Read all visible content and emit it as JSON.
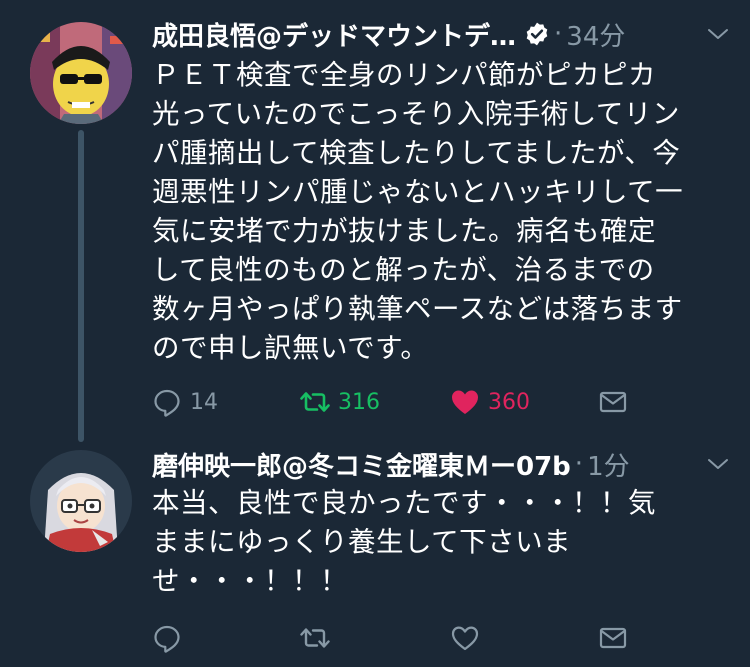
{
  "tweets": [
    {
      "author": "成田良悟@デッドマウントデ…",
      "verified": true,
      "separator": "·",
      "time": "34分",
      "text": "ＰＥＴ検査で全身のリンパ節がピカピカ\n光っていたのでこっそり入院手術してリン\nパ腫摘出して検査したりしてましたが、今\n週悪性リンパ腫じゃないとハッキリして一\n気に安堵で力が抜けました。病名も確定\nして良性のものと解ったが、治るまでの\n数ヶ月やっぱり執筆ペースなどは落ちます\nので申し訳無いです。",
      "replies": "14",
      "retweets": "316",
      "likes": "360",
      "retweeted": true,
      "liked": true
    },
    {
      "author": "磨伸映一郎@冬コミ金曜東Ｍー07b",
      "verified": false,
      "separator": "·",
      "time": "1分",
      "text": "本当、良性で良かったです・・・！！気\nままにゆっくり養生して下さいま\nせ・・・！！！",
      "replies": "",
      "retweets": "",
      "likes": "",
      "retweeted": false,
      "liked": false
    }
  ],
  "colors": {
    "background": "#1b2836",
    "muted": "#8899a6",
    "retweet": "#17bf63",
    "like": "#e0245e"
  }
}
